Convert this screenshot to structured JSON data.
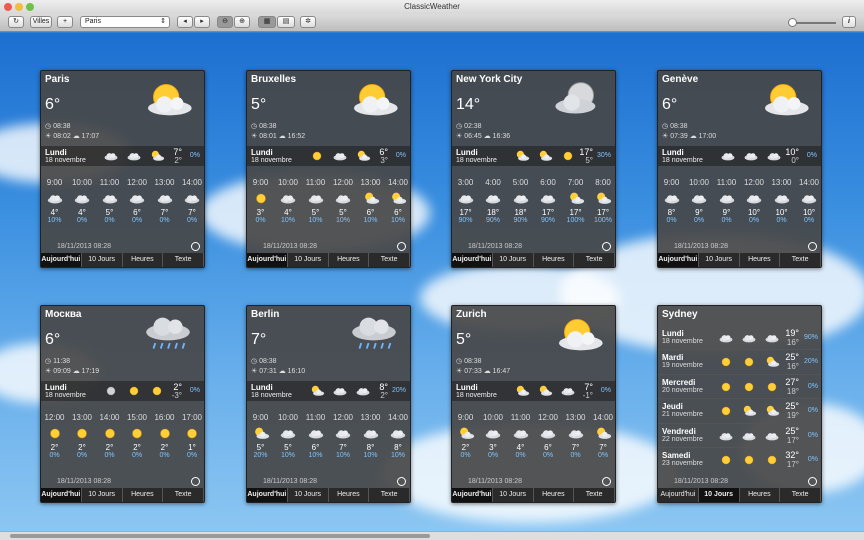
{
  "window": {
    "title": "ClassicWeather"
  },
  "toolbar": {
    "villes": "Villes",
    "add": "+",
    "city": "Paris",
    "prev": "◂",
    "next": "▸",
    "info": "i"
  },
  "colors": {
    "precip": "#7fc4ff",
    "panel": "#464646",
    "sky": "#2d7fd4"
  },
  "tabs": [
    "Aujourd'hui",
    "10 Jours",
    "Heures",
    "Texte"
  ],
  "panels": [
    {
      "name": "Paris",
      "temp": "6°",
      "duration": "08:38",
      "sunrise": "08:02",
      "sunset": "17:07",
      "icon": "sun-cloud-icon",
      "today": {
        "day": "Lundi",
        "date": "18 novembre",
        "hi": "7°",
        "lo": "2°",
        "precip": "0%",
        "icons": [
          "cloud",
          "cloud",
          "sun-cloud"
        ]
      },
      "hours": [
        "9:00",
        "10:00",
        "11:00",
        "12:00",
        "13:00",
        "14:00"
      ],
      "hicons": [
        "cloud",
        "cloud",
        "cloud",
        "cloud",
        "cloud",
        "cloud"
      ],
      "htemps": [
        "4°",
        "4°",
        "5°",
        "6°",
        "7°",
        "7°"
      ],
      "hprec": [
        "10%",
        "0%",
        "0%",
        "0%",
        "0%",
        "0%"
      ],
      "stamp": "18/11/2013 08:28",
      "selected": 0
    },
    {
      "name": "Bruxelles",
      "temp": "5°",
      "duration": "08:38",
      "sunrise": "08:01",
      "sunset": "16:52",
      "icon": "sun-cloud-icon",
      "today": {
        "day": "Lundi",
        "date": "18 novembre",
        "hi": "6°",
        "lo": "3°",
        "precip": "0%",
        "icons": [
          "sun",
          "cloud",
          "sun-cloud"
        ]
      },
      "hours": [
        "9:00",
        "10:00",
        "11:00",
        "12:00",
        "13:00",
        "14:00"
      ],
      "hicons": [
        "sun",
        "cloud",
        "cloud",
        "cloud",
        "sun-cloud",
        "sun-cloud"
      ],
      "htemps": [
        "3°",
        "4°",
        "5°",
        "5°",
        "6°",
        "6°"
      ],
      "hprec": [
        "0%",
        "10%",
        "10%",
        "10%",
        "10%",
        "10%"
      ],
      "stamp": "18/11/2013 08:28",
      "selected": 0
    },
    {
      "name": "New York City",
      "temp": "14°",
      "duration": "02:38",
      "sunrise": "06:45",
      "sunset": "16:36",
      "icon": "moon-cloud-icon",
      "today": {
        "day": "Lundi",
        "date": "18 novembre",
        "hi": "17°",
        "lo": "5°",
        "precip": "30%",
        "icons": [
          "sun-cloud",
          "sun-cloud",
          "sun"
        ]
      },
      "hours": [
        "3:00",
        "4:00",
        "5:00",
        "6:00",
        "7:00",
        "8:00"
      ],
      "hicons": [
        "cloud",
        "cloud",
        "cloud",
        "cloud",
        "sun-cloud",
        "sun-cloud"
      ],
      "htemps": [
        "17°",
        "18°",
        "18°",
        "17°",
        "17°",
        "17°"
      ],
      "hprec": [
        "90%",
        "90%",
        "90%",
        "90%",
        "100%",
        "100%"
      ],
      "stamp": "18/11/2013 08:28",
      "selected": 0
    },
    {
      "name": "Genève",
      "temp": "6°",
      "duration": "08:38",
      "sunrise": "07:39",
      "sunset": "17:00",
      "icon": "sun-cloud-icon",
      "today": {
        "day": "Lundi",
        "date": "18 novembre",
        "hi": "10°",
        "lo": "0°",
        "precip": "0%",
        "icons": [
          "cloud",
          "cloud",
          "cloud"
        ]
      },
      "hours": [
        "9:00",
        "10:00",
        "11:00",
        "12:00",
        "13:00",
        "14:00"
      ],
      "hicons": [
        "cloud",
        "cloud",
        "cloud",
        "cloud",
        "cloud",
        "cloud"
      ],
      "htemps": [
        "8°",
        "9°",
        "9°",
        "10°",
        "10°",
        "10°"
      ],
      "hprec": [
        "0%",
        "0%",
        "0%",
        "0%",
        "0%",
        "0%"
      ],
      "stamp": "18/11/2013 08:28",
      "selected": 0
    },
    {
      "name": "Москва",
      "temp": "6°",
      "duration": "11:38",
      "sunrise": "09:09",
      "sunset": "17:19",
      "icon": "rain-cloud-icon",
      "today": {
        "day": "Lundi",
        "date": "18 novembre",
        "hi": "2°",
        "lo": "-3°",
        "precip": "0%",
        "icons": [
          "moon",
          "sun",
          "sun"
        ]
      },
      "hours": [
        "12:00",
        "13:00",
        "14:00",
        "15:00",
        "16:00",
        "17:00"
      ],
      "hicons": [
        "sun",
        "sun",
        "sun",
        "sun",
        "sun",
        "sun"
      ],
      "htemps": [
        "2°",
        "2°",
        "2°",
        "2°",
        "2°",
        "1°"
      ],
      "hprec": [
        "0%",
        "0%",
        "0%",
        "0%",
        "0%",
        "0%"
      ],
      "stamp": "18/11/2013 08:28",
      "selected": 0
    },
    {
      "name": "Berlin",
      "temp": "7°",
      "duration": "08:38",
      "sunrise": "07:31",
      "sunset": "16:10",
      "icon": "rain-cloud-icon",
      "today": {
        "day": "Lundi",
        "date": "18 novembre",
        "hi": "8°",
        "lo": "2°",
        "precip": "20%",
        "icons": [
          "sun-cloud",
          "cloud",
          "cloud"
        ]
      },
      "hours": [
        "9:00",
        "10:00",
        "11:00",
        "12:00",
        "13:00",
        "14:00"
      ],
      "hicons": [
        "sun-cloud",
        "cloud",
        "cloud",
        "cloud",
        "cloud",
        "cloud"
      ],
      "htemps": [
        "5°",
        "5°",
        "6°",
        "7°",
        "8°",
        "8°"
      ],
      "hprec": [
        "20%",
        "10%",
        "10%",
        "10%",
        "10%",
        "10%"
      ],
      "stamp": "18/11/2013 08:28",
      "selected": 0
    },
    {
      "name": "Zurich",
      "temp": "5°",
      "duration": "08:38",
      "sunrise": "07:33",
      "sunset": "16:47",
      "icon": "sun-cloud-icon",
      "today": {
        "day": "Lundi",
        "date": "18 novembre",
        "hi": "7°",
        "lo": "-1°",
        "precip": "0%",
        "icons": [
          "sun-cloud",
          "sun-cloud",
          "cloud"
        ]
      },
      "hours": [
        "9:00",
        "10:00",
        "11:00",
        "12:00",
        "13:00",
        "14:00"
      ],
      "hicons": [
        "sun-cloud",
        "cloud",
        "cloud",
        "cloud",
        "cloud",
        "sun-cloud"
      ],
      "htemps": [
        "2°",
        "3°",
        "4°",
        "6°",
        "7°",
        "7°"
      ],
      "hprec": [
        "0%",
        "0%",
        "0%",
        "0%",
        "0%",
        "0%"
      ],
      "stamp": "18/11/2013 08:28",
      "selected": 0
    }
  ],
  "sydney": {
    "name": "Sydney",
    "stamp": "18/11/2013 08:28",
    "selected": 1,
    "days": [
      {
        "day": "Lundi",
        "date": "18 novembre",
        "hi": "19°",
        "lo": "16°",
        "precip": "90%",
        "icons": [
          "cloud",
          "cloud",
          "cloud"
        ]
      },
      {
        "day": "Mardi",
        "date": "19 novembre",
        "hi": "25°",
        "lo": "16°",
        "precip": "20%",
        "icons": [
          "sun",
          "sun",
          "sun-cloud"
        ]
      },
      {
        "day": "Mercredi",
        "date": "20 novembre",
        "hi": "27°",
        "lo": "18°",
        "precip": "0%",
        "icons": [
          "sun",
          "sun",
          "sun"
        ]
      },
      {
        "day": "Jeudi",
        "date": "21 novembre",
        "hi": "25°",
        "lo": "19°",
        "precip": "0%",
        "icons": [
          "sun",
          "sun-cloud",
          "sun-cloud"
        ]
      },
      {
        "day": "Vendredi",
        "date": "22 novembre",
        "hi": "25°",
        "lo": "17°",
        "precip": "0%",
        "icons": [
          "cloud",
          "cloud",
          "cloud"
        ]
      },
      {
        "day": "Samedi",
        "date": "23 novembre",
        "hi": "32°",
        "lo": "17°",
        "precip": "0%",
        "icons": [
          "sun",
          "sun",
          "sun"
        ]
      }
    ]
  }
}
